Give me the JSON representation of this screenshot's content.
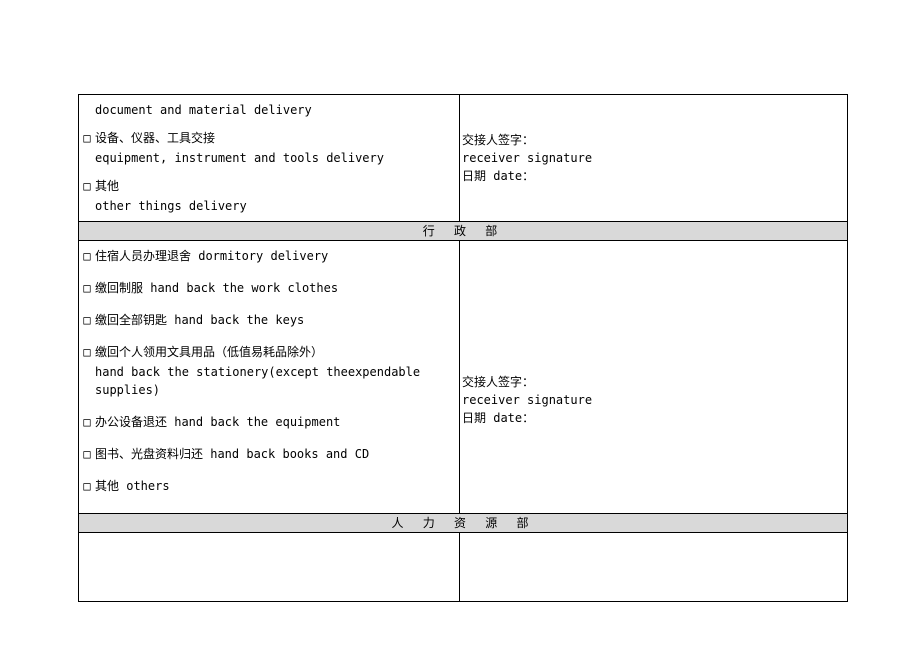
{
  "section1": {
    "items": {
      "doc_en": "document and material delivery",
      "equip_cn": "设备、仪器、工具交接",
      "equip_en": "equipment, instrument and tools delivery",
      "other_cn": "其他",
      "other_en": "other things delivery"
    },
    "sig": {
      "receiver_cn": "交接人签字：",
      "receiver_en": "receiver signature",
      "date": "日期 date："
    }
  },
  "header_admin": "行 政 部",
  "section2": {
    "items": {
      "dorm": "住宿人员办理退舍 dormitory delivery",
      "clothes": "缴回制服 hand back the work clothes",
      "keys": "缴回全部钥匙 hand back the keys",
      "stationery_cn": "缴回个人领用文具用品（低值易耗品除外）",
      "stationery_en": "hand back the stationery(except theexpendable supplies)",
      "equipment": "办公设备退还 hand back the equipment",
      "books": "图书、光盘资料归还 hand back books and CD",
      "others": "其他 others"
    },
    "sig": {
      "receiver_cn": "交接人签字：",
      "receiver_en": "receiver signature",
      "date": "日期 date："
    }
  },
  "header_hr": "人 力 资 源 部"
}
